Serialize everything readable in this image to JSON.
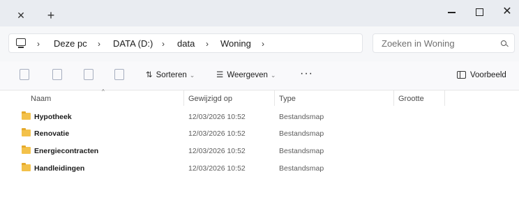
{
  "titlebar": {
    "tab_close_glyph": "✕",
    "new_tab_glyph": "+",
    "close_glyph": "✕"
  },
  "address": {
    "breadcrumbs": [
      {
        "label": "Deze pc"
      },
      {
        "label": "DATA (D:)"
      },
      {
        "label": "data"
      },
      {
        "label": "Woning"
      }
    ],
    "separator": "›"
  },
  "search": {
    "placeholder": "Zoeken in Woning"
  },
  "toolbar": {
    "sort_label": "Sorteren",
    "sort_glyph": "⇅",
    "view_label": "Weergeven",
    "view_glyph": "☰",
    "more_label": "···",
    "chevron": "⌄",
    "preview_label": "Voorbeeld"
  },
  "list": {
    "columns": {
      "name": "Naam",
      "modified": "Gewijzigd op",
      "type": "Type",
      "size": "Grootte"
    },
    "sort_indicator": "^",
    "rows": [
      {
        "name": "Hypotheek",
        "modified": "12/03/2026 10:52",
        "type": "Bestandsmap"
      },
      {
        "name": "Renovatie",
        "modified": "12/03/2026 10:52",
        "type": "Bestandsmap"
      },
      {
        "name": "Energiecontracten",
        "modified": "12/03/2026 10:52",
        "type": "Bestandsmap"
      },
      {
        "name": "Handleidingen",
        "modified": "12/03/2026 10:52",
        "type": "Bestandsmap"
      }
    ]
  },
  "colors": {
    "folder": "#f3c14a",
    "background": "#eef0f4"
  }
}
